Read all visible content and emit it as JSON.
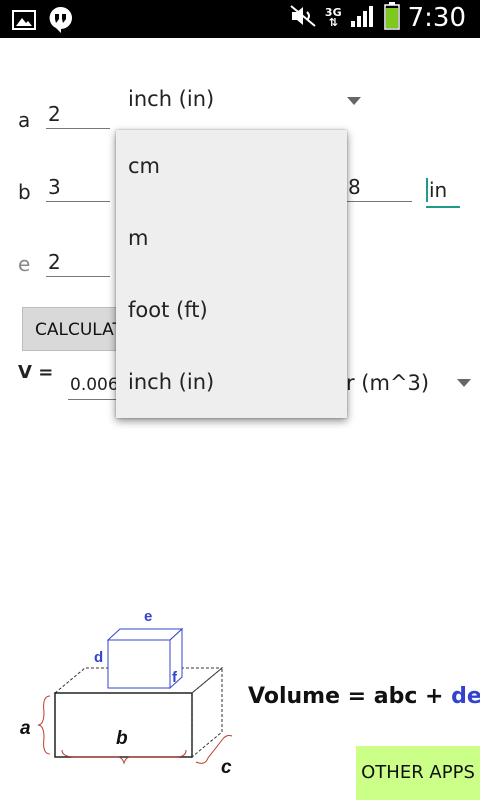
{
  "status_bar": {
    "time": "7:30",
    "network": "3G",
    "icons": [
      "image-icon",
      "hangouts-icon",
      "mute-icon",
      "signal-icon",
      "battery-icon"
    ]
  },
  "inputs": {
    "a": {
      "label": "a",
      "value": "2"
    },
    "b": {
      "label": "b",
      "value": "3"
    },
    "e": {
      "label": "e",
      "value": "2"
    },
    "hidden_field_value": "8",
    "unit_field_value": "in"
  },
  "unit_spinner": {
    "selected": "inch (in)"
  },
  "calculate_button": {
    "label": "CALCULATE"
  },
  "result": {
    "label": "V =",
    "value": "0.006",
    "unit_label": "r (m^3)"
  },
  "dropdown": {
    "options": [
      "cm",
      "m",
      "foot (ft)",
      "inch (in)"
    ]
  },
  "diagram": {
    "labels": {
      "a": "a",
      "b": "b",
      "c": "c",
      "d": "d",
      "e": "e",
      "f": "f"
    },
    "formula_prefix": "Volume = abc + ",
    "formula_suffix": "def"
  },
  "other_apps_button": {
    "label": "OTHER APPS"
  },
  "colors": {
    "accent": "#1e9b8a",
    "formula_blue": "#3344cc",
    "other_apps_bg": "#ccff88"
  }
}
